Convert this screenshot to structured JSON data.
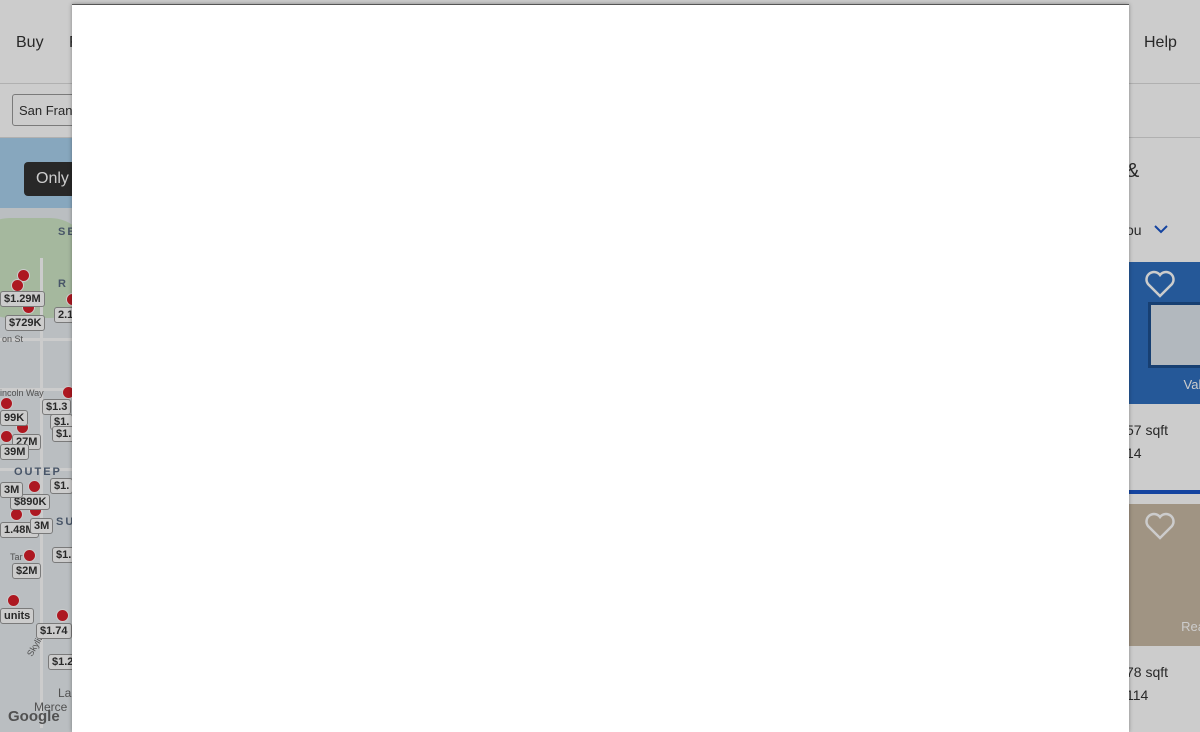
{
  "nav": {
    "items": [
      {
        "label": "Buy"
      },
      {
        "label": "R"
      },
      {
        "label": "Help"
      }
    ]
  },
  "search": {
    "value": "San Franc"
  },
  "map": {
    "only_button_label": "Only",
    "area_labels": [
      "SE",
      "R",
      "OUTEP",
      "SU"
    ],
    "street_labels": [
      "on St",
      "incoln Way",
      "Tar   St",
      "Skyline",
      "La",
      "Merce"
    ],
    "price_tags": [
      "$1.29M",
      "$729K",
      "2.1",
      "99K",
      "$1.3",
      "$1.",
      "27M",
      "$1.",
      "39M",
      "$1.",
      "$890K",
      "3M",
      "1.48M",
      "3M",
      "$1.",
      "$2M",
      "units",
      "$1.74",
      "$1.2"
    ],
    "logo_text": "Google",
    "colors": {
      "water": "#a9d1ee",
      "pin": "#d91e2a"
    }
  },
  "results": {
    "heading": "&",
    "sort_label": "ou",
    "cards": [
      {
        "overlay": "Valley",
        "line1": "57 sqft",
        "line2": "14"
      },
      {
        "overlay": "Realty",
        "line1": "78 sqft",
        "line2": "114"
      }
    ]
  },
  "modal": {
    "state": "open"
  }
}
